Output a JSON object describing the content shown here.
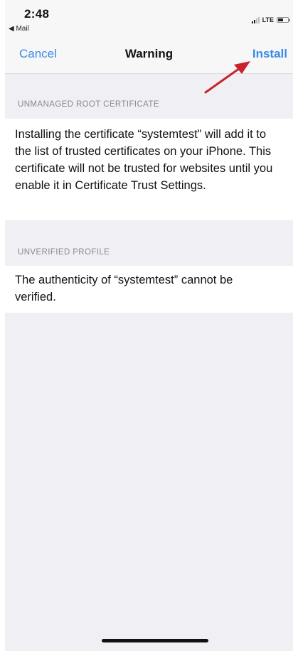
{
  "status_bar": {
    "time": "2:48",
    "back_app": "◀ Mail",
    "network": "LTE"
  },
  "nav": {
    "cancel_label": "Cancel",
    "title": "Warning",
    "install_label": "Install"
  },
  "sections": [
    {
      "header": "UNMANAGED ROOT CERTIFICATE",
      "body": "Installing the certificate “systemtest” will add it to the list of trusted certificates on your iPhone. This certificate will not be trusted for websites until you enable it in Certificate Trust Settings."
    },
    {
      "header": "UNVERIFIED PROFILE",
      "body": "The authenticity of “systemtest” cannot be verified."
    }
  ],
  "colors": {
    "accent": "#3b8be6",
    "annotation_arrow": "#c8232c",
    "background": "#efeff4"
  },
  "icons": [
    "signal-icon",
    "battery-icon",
    "annotation-arrow-icon"
  ]
}
